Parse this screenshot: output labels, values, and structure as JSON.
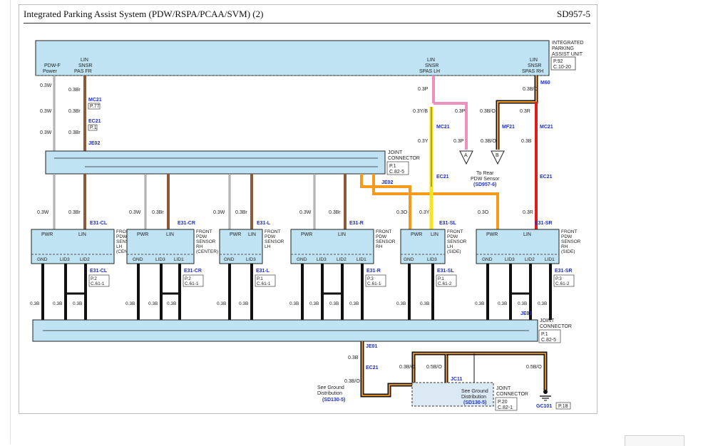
{
  "header": {
    "title": "Integrated Parking Assist System (PDW/RSPA/PCAA/SVM) (2)",
    "code": "SD957-5"
  },
  "unit": {
    "name": [
      "INTEGRATED",
      "PARKING",
      "ASSIST UNIT"
    ],
    "ref": [
      "P.92",
      "C.10-20"
    ],
    "pins": [
      [
        "PDW-F",
        "Power"
      ],
      [
        "LIN",
        "SNSR",
        "PAS FR"
      ],
      [
        "LIN",
        "SNSR",
        "SPAS LH"
      ],
      [
        "LIN",
        "SNSR",
        "SPAS RH"
      ]
    ]
  },
  "connectors": {
    "mc21": "MC21",
    "ec21": "EC21",
    "je02": "JE02",
    "mf21": "MF21",
    "m60": "M60",
    "je01": "JE01",
    "jc11": "JC11",
    "gc101": "GC101",
    "p77": "P.77",
    "p1": "P.1",
    "p18": "P.18",
    "joint": [
      "JOINT",
      "CONNECTOR"
    ],
    "jref": [
      "P.1",
      "C.82-5"
    ],
    "jref2": [
      "P.20",
      "C.82-1"
    ]
  },
  "wires": {
    "w03w": "0.3W",
    "w03br": "0.3Br",
    "w03p": "0.3P",
    "w03y": "0.3Y",
    "w03yb": "0.3Y/B",
    "w03bo": "0.3B/O",
    "w03r": "0.3R",
    "w03o": "0.3O",
    "w03b": "0.3B",
    "w05bo": "0.5B/O"
  },
  "rear": {
    "a": "A",
    "b": "B",
    "label": [
      "To Rear",
      "PDW Sensor"
    ],
    "ref": "(SD957-6)"
  },
  "sensors": [
    {
      "conn": "E31-CL",
      "name": [
        "FRONT",
        "PDW",
        "SENSOR",
        "LH",
        "(CENTER)"
      ],
      "gnd": [
        "GND",
        "LID3",
        "LID2"
      ],
      "ref": [
        "P.2",
        "C.61-1"
      ]
    },
    {
      "conn": "E31-CR",
      "name": [
        "FRONT",
        "PDW",
        "SENSOR",
        "RH",
        "(CENTER)"
      ],
      "gnd": [
        "GND",
        "LID3",
        "LID1"
      ],
      "ref": [
        "P.2",
        "C.61-1"
      ]
    },
    {
      "conn": "E31-L",
      "name": [
        "FRONT",
        "PDW",
        "SENSOR",
        "LH"
      ],
      "gnd": [
        "GND",
        "LID3"
      ],
      "ref": [
        "P.1",
        "C.61-1"
      ]
    },
    {
      "conn": "E31-R",
      "name": [
        "FRONT",
        "PDW",
        "SENSOR",
        "RH"
      ],
      "gnd": [
        "GND",
        "LID3",
        "LID2",
        "LID1"
      ],
      "ref": [
        "P.3",
        "C.61-1"
      ]
    },
    {
      "conn": "E31-SL",
      "name": [
        "FRONT",
        "PDW",
        "SENSOR",
        "LH",
        "(SIDE)"
      ],
      "gnd": [
        "GND",
        "LID3"
      ],
      "ref": [
        "P.1",
        "C.61-2"
      ]
    },
    {
      "conn": "E31-SR",
      "name": [
        "FRONT",
        "PDW",
        "SENSOR",
        "RH",
        "(SIDE)"
      ],
      "gnd": [
        "GND",
        "LID3",
        "LID2",
        "LID1"
      ],
      "ref": [
        "P.3",
        "C.61-2"
      ]
    }
  ],
  "pinlabels": {
    "pwr": "PWR",
    "lin": "LIN"
  },
  "ground": {
    "see": [
      "See Ground",
      "Distribution"
    ],
    "ref": "(SD130-5)"
  }
}
